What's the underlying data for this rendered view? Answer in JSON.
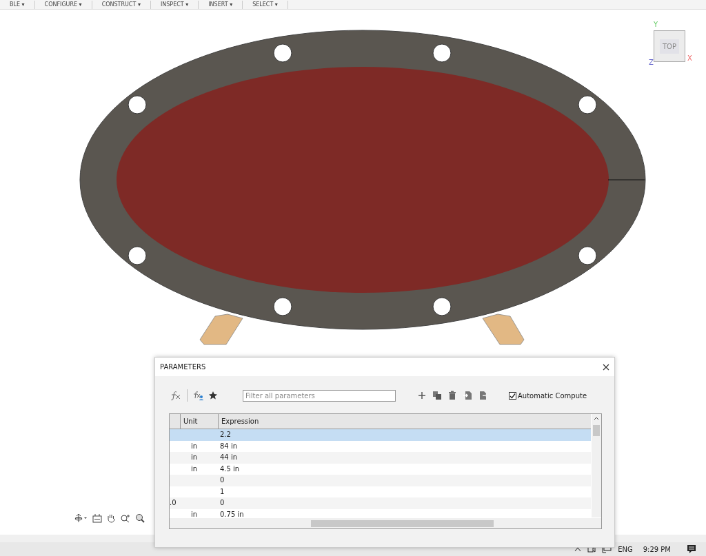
{
  "menu": [
    {
      "label": "BLE ▾"
    },
    {
      "label": "CONFIGURE ▾"
    },
    {
      "label": "CONSTRUCT ▾"
    },
    {
      "label": "INSPECT ▾"
    },
    {
      "label": "INSERT ▾"
    },
    {
      "label": "SELECT ▾"
    }
  ],
  "view_cube": {
    "face": "TOP",
    "axes": [
      "Y",
      "X",
      "Z"
    ]
  },
  "parameters": {
    "title": "PARAMETERS",
    "filter": {
      "placeholder": "Filter all parameters"
    },
    "automatic_compute": {
      "label": "Automatic Compute",
      "checked": true
    },
    "columns": [
      "Unit",
      "Expression"
    ],
    "rows": [
      {
        "column_1": "",
        "unit": "",
        "expression": "2.2",
        "selected": true
      },
      {
        "column_1": "",
        "unit": "in",
        "expression": "84 in",
        "selected": false
      },
      {
        "column_1": "",
        "unit": "in",
        "expression": "44 in",
        "selected": false
      },
      {
        "column_1": "",
        "unit": "in",
        "expression": "4.5 in",
        "selected": false
      },
      {
        "column_1": "",
        "unit": "",
        "expression": "0",
        "selected": false
      },
      {
        "column_1": "",
        "unit": "",
        "expression": "1",
        "selected": false
      },
      {
        "column_1": ".0",
        "unit": "",
        "expression": "0",
        "selected": false
      },
      {
        "column_1": "",
        "unit": "in",
        "expression": "0.75 in",
        "selected": false
      }
    ]
  },
  "taskbar": {
    "language": "ENG",
    "time": "9:29 PM"
  }
}
